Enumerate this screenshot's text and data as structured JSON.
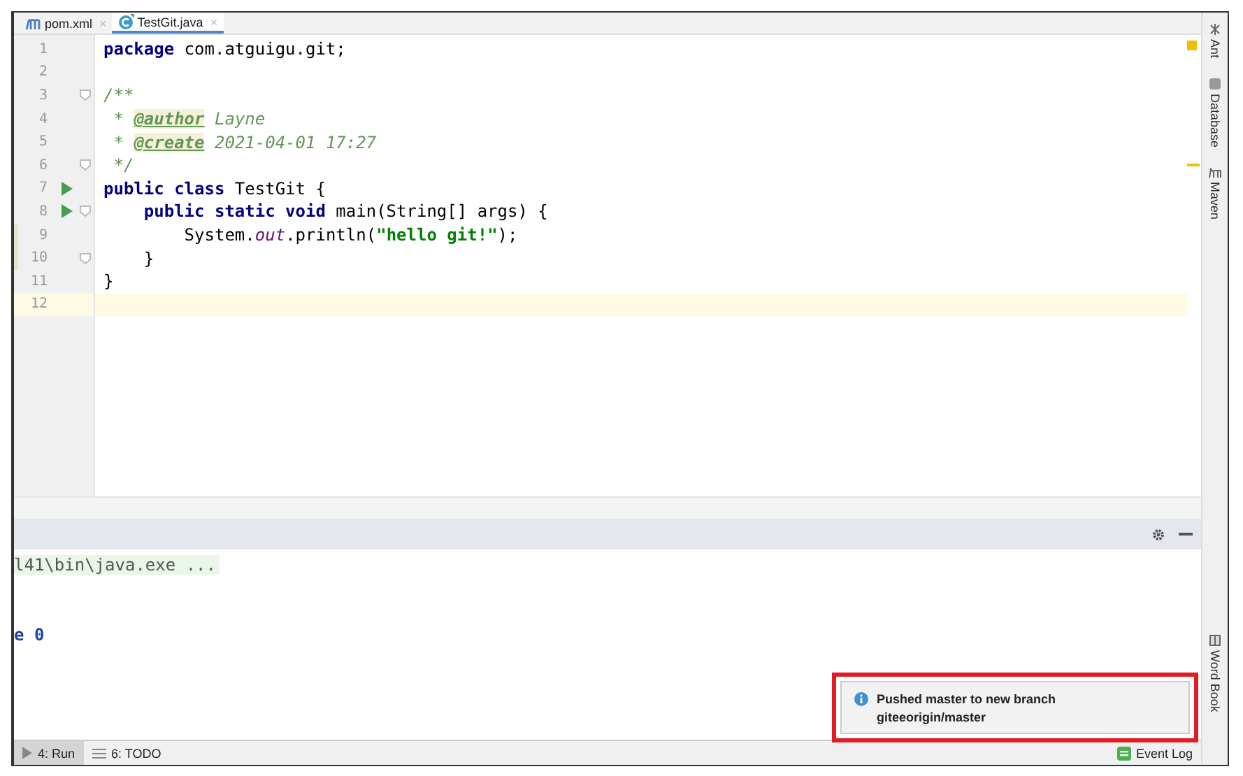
{
  "tabs": [
    {
      "label": "pom.xml",
      "kind": "maven",
      "close": "×",
      "selected": false
    },
    {
      "label": "TestGit.java",
      "kind": "java",
      "close": "×",
      "selected": true
    }
  ],
  "code_lines": [
    {
      "number": "1",
      "run": false,
      "fold": false,
      "changed": false,
      "current": false,
      "tokens": [
        {
          "text": "package",
          "kind": "keyword"
        },
        {
          "text": " com.atguigu.git;",
          "kind": "plain"
        }
      ]
    },
    {
      "number": "2",
      "run": false,
      "fold": false,
      "changed": false,
      "current": false
    },
    {
      "number": "3",
      "run": false,
      "fold": true,
      "changed": false,
      "current": false,
      "tokens": [
        {
          "text": "/**",
          "kind": "comment"
        }
      ]
    },
    {
      "number": "4",
      "run": false,
      "fold": false,
      "changed": false,
      "current": false,
      "tokens": [
        {
          "text": " * ",
          "kind": "comment"
        },
        {
          "text": "@author",
          "kind": "tag"
        },
        {
          "text": " Layne",
          "kind": "comment"
        }
      ]
    },
    {
      "number": "5",
      "run": false,
      "fold": false,
      "changed": false,
      "current": false,
      "tokens": [
        {
          "text": " * ",
          "kind": "comment"
        },
        {
          "text": "@create",
          "kind": "tag"
        },
        {
          "text": " 2021-04-01 17:27",
          "kind": "comment"
        }
      ]
    },
    {
      "number": "6",
      "run": false,
      "fold": true,
      "changed": false,
      "current": false,
      "tokens": [
        {
          "text": " */",
          "kind": "comment"
        }
      ]
    },
    {
      "number": "7",
      "run": true,
      "fold": false,
      "changed": false,
      "current": false,
      "tokens": [
        {
          "text": "public class",
          "kind": "keyword"
        },
        {
          "text": " TestGit {",
          "kind": "plain"
        }
      ]
    },
    {
      "number": "8",
      "run": true,
      "fold": true,
      "changed": false,
      "current": false,
      "tokens": [
        {
          "text": "    public static void",
          "kind": "keyword"
        },
        {
          "text": " main(String[] args) {",
          "kind": "plain"
        }
      ]
    },
    {
      "number": "9",
      "run": false,
      "fold": false,
      "changed": true,
      "current": false,
      "tokens": [
        {
          "text": "        System.",
          "kind": "plain"
        },
        {
          "text": "out",
          "kind": "field"
        },
        {
          "text": ".println(",
          "kind": "plain"
        },
        {
          "text": "\"hello git!\"",
          "kind": "string"
        },
        {
          "text": ");",
          "kind": "plain"
        }
      ]
    },
    {
      "number": "10",
      "run": false,
      "fold": true,
      "changed": true,
      "current": false,
      "tokens": [
        {
          "text": "    }",
          "kind": "plain"
        }
      ]
    },
    {
      "number": "11",
      "run": false,
      "fold": false,
      "changed": false,
      "current": false,
      "tokens": [
        {
          "text": "}",
          "kind": "plain"
        }
      ]
    },
    {
      "number": "12",
      "run": false,
      "fold": false,
      "changed": false,
      "current": true
    }
  ],
  "console_lines": [
    {
      "text": "l41\\bin\\java.exe ...",
      "kind": "command"
    },
    {
      "kind": "blank"
    },
    {
      "kind": "blank"
    },
    {
      "text": "e 0",
      "kind": "exit"
    }
  ],
  "side_tools": [
    {
      "label": "Ant",
      "kind": "ant"
    },
    {
      "label": "Database",
      "kind": "database"
    },
    {
      "label": "Maven",
      "kind": "maven"
    }
  ],
  "side_tools_bottom": [
    {
      "label": "Word Book",
      "kind": "book"
    }
  ],
  "bottom_tabs": [
    {
      "label": "4: Run",
      "kind": "run",
      "selected": true
    },
    {
      "label": "6: TODO",
      "kind": "todo",
      "selected": false
    }
  ],
  "event_log": "Event Log",
  "notification": {
    "lines": [
      "Pushed master to new branch",
      "giteeorigin/master"
    ],
    "highlighted": true
  }
}
